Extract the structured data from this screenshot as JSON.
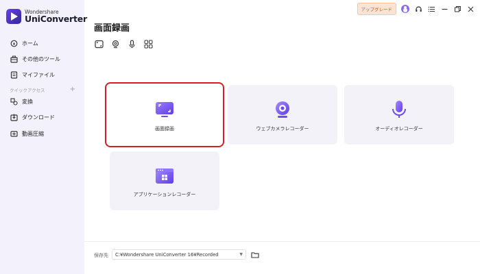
{
  "app": {
    "brand": "Wondershare",
    "product": "UniConverter"
  },
  "sidebar": {
    "items": [
      {
        "label": "ホーム",
        "icon": "home-icon"
      },
      {
        "label": "その他のツール",
        "icon": "toolbox-icon"
      },
      {
        "label": "マイファイル",
        "icon": "file-icon"
      }
    ],
    "quick_access_label": "クイックアクセス",
    "quick_items": [
      {
        "label": "変換",
        "icon": "convert-icon"
      },
      {
        "label": "ダウンロード",
        "icon": "download-icon"
      },
      {
        "label": "動画圧縮",
        "icon": "compress-icon"
      }
    ]
  },
  "topbar": {
    "upgrade_label": "アップグレード",
    "icons": [
      "avatar",
      "headset-icon",
      "menu-icon",
      "minimize-icon",
      "restore-icon",
      "close-icon"
    ]
  },
  "main": {
    "title": "画面録画",
    "modes": [
      "screen-icon",
      "webcam-icon",
      "mic-icon",
      "apps-icon"
    ],
    "cards": [
      {
        "label": "画面録画",
        "icon": "screen-record-icon",
        "selected": true
      },
      {
        "label": "ウェブカメラレコーダー",
        "icon": "webcam-record-icon",
        "selected": false
      },
      {
        "label": "オーディオレコーダー",
        "icon": "audio-record-icon",
        "selected": false
      },
      {
        "label": "アプリケーションレコーダー",
        "icon": "app-record-icon",
        "selected": false
      }
    ]
  },
  "footer": {
    "save_label": "保存先",
    "save_path": "C:¥Wondershare UniConverter 16¥Recorded"
  },
  "colors": {
    "accent": "#7a55f0",
    "selection_border": "#d62020",
    "sidebar_bg": "#f3f1fb",
    "upgrade_bg": "#fde3d3"
  }
}
